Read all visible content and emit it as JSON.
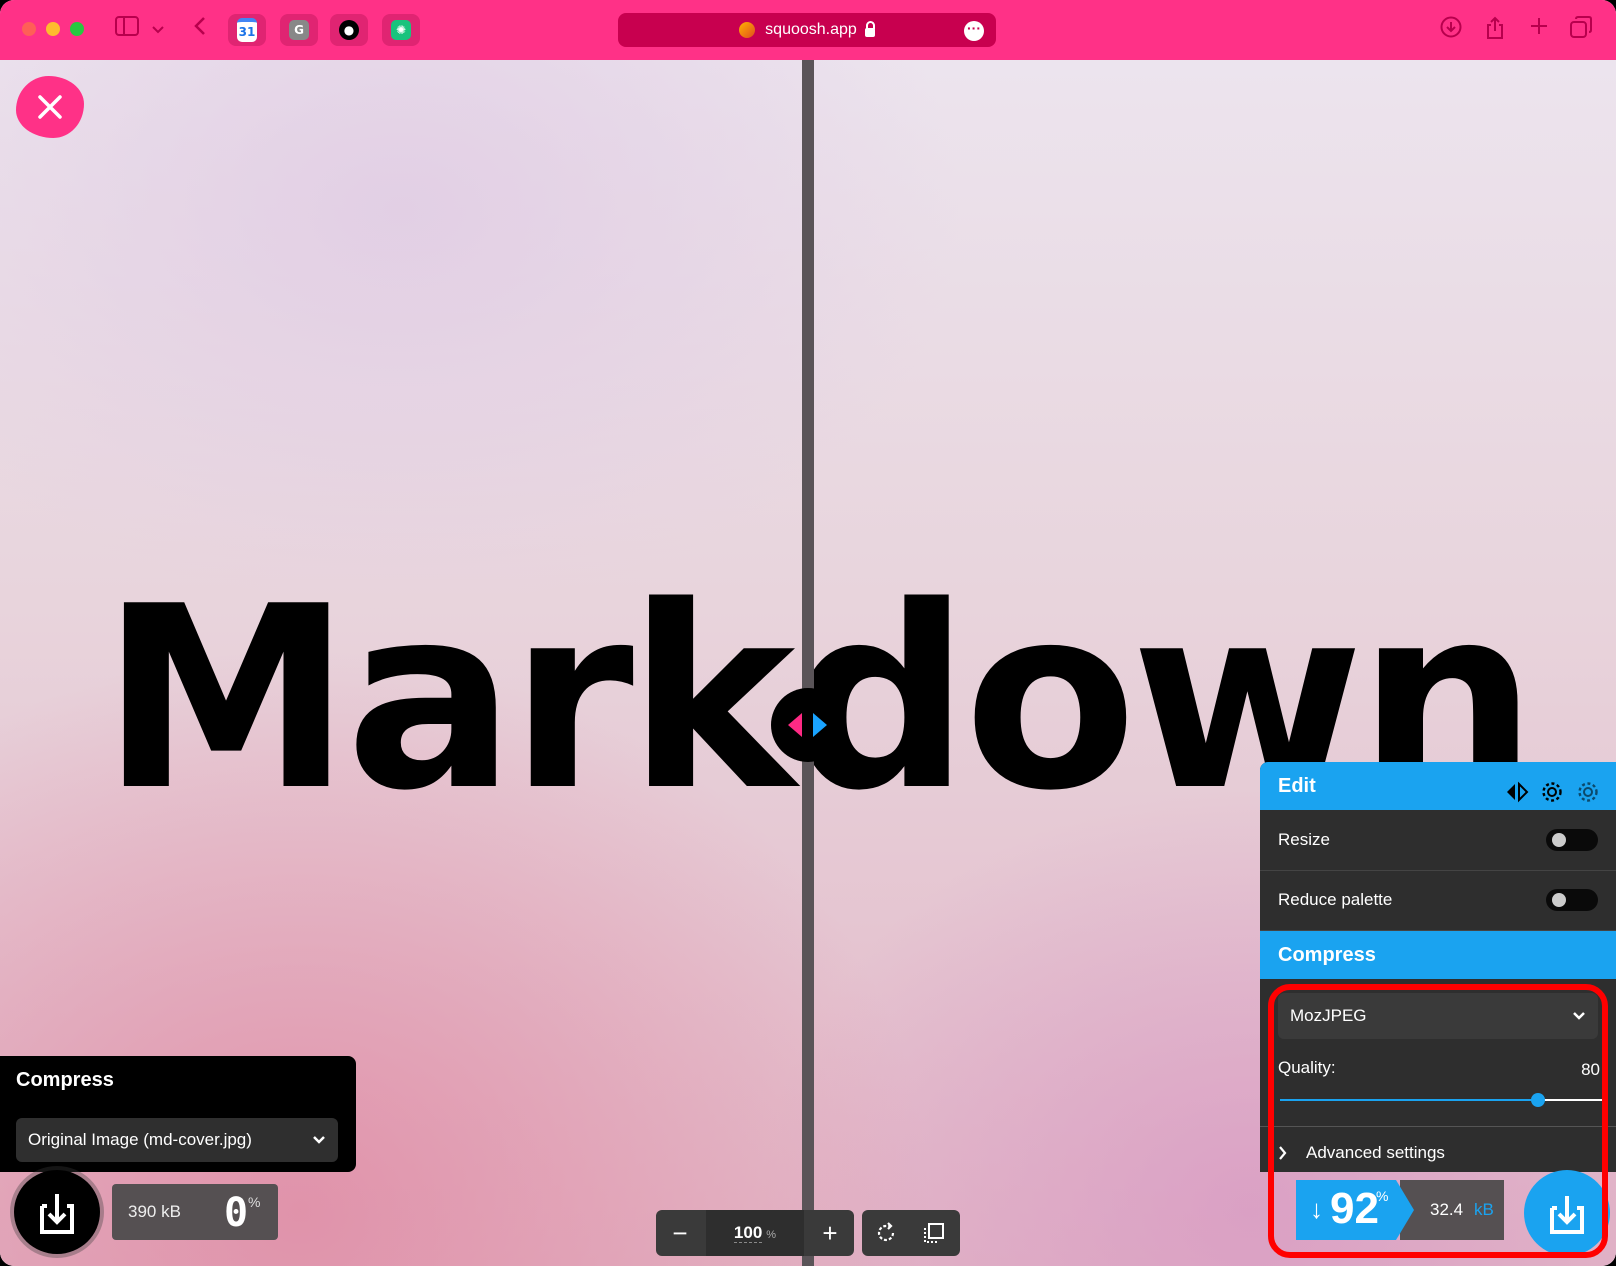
{
  "browser": {
    "url": "squoosh.app",
    "tabs": [
      {
        "name": "google-calendar",
        "glyph": "31"
      },
      {
        "name": "google",
        "glyph": "G"
      },
      {
        "name": "github",
        "glyph": "●"
      },
      {
        "name": "chatgpt",
        "glyph": "✺"
      }
    ]
  },
  "canvas": {
    "image_text": "Markdown"
  },
  "left_panel": {
    "title": "Compress",
    "select_value": "Original Image (md-cover.jpg)",
    "size_value": "390 kB",
    "percent": "0",
    "percent_unit": "%"
  },
  "zoom": {
    "value": "100",
    "unit": "%",
    "minus": "−",
    "plus": "+"
  },
  "edit_panel": {
    "title": "Edit",
    "resize_label": "Resize",
    "resize_on": false,
    "reduce_palette_label": "Reduce palette",
    "reduce_palette_on": false,
    "compress_title": "Compress",
    "codec": "MozJPEG",
    "quality_label": "Quality:",
    "quality_value": "80",
    "quality_fraction": 0.8,
    "advanced_label": "Advanced settings"
  },
  "right_result": {
    "arrow": "↓",
    "percent": "92",
    "percent_unit": "%",
    "size_value": "32.4",
    "size_unit": "kB"
  },
  "colors": {
    "brand_pink": "#ff3187",
    "accent_blue": "#1aa3f0",
    "highlight_red": "#ff0000"
  }
}
